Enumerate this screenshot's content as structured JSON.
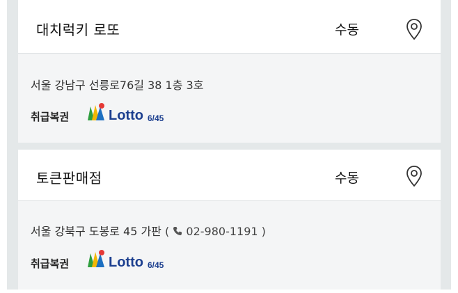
{
  "stores": [
    {
      "name": "대치럭키 로또",
      "type": "수동",
      "address": "서울 강남구 선릉로76길 38 1층 3호",
      "phone": "",
      "lottery_label": "취급복권",
      "lottery_logo_text": "Lotto",
      "lottery_logo_sub": "6/45"
    },
    {
      "name": "토큰판매점",
      "type": "수동",
      "address": "서울 강북구 도봉로 45 가판",
      "phone": "02-980-1191",
      "lottery_label": "취급복권",
      "lottery_logo_text": "Lotto",
      "lottery_logo_sub": "6/45"
    }
  ],
  "icons": {
    "location": "map-pin-icon",
    "phone": "phone-icon",
    "lotto": "lotto-logo"
  },
  "colors": {
    "background": "#e4e8e9",
    "card": "#ffffff",
    "body": "#f4f5f6",
    "lotto_blue": "#1c3f8f"
  }
}
